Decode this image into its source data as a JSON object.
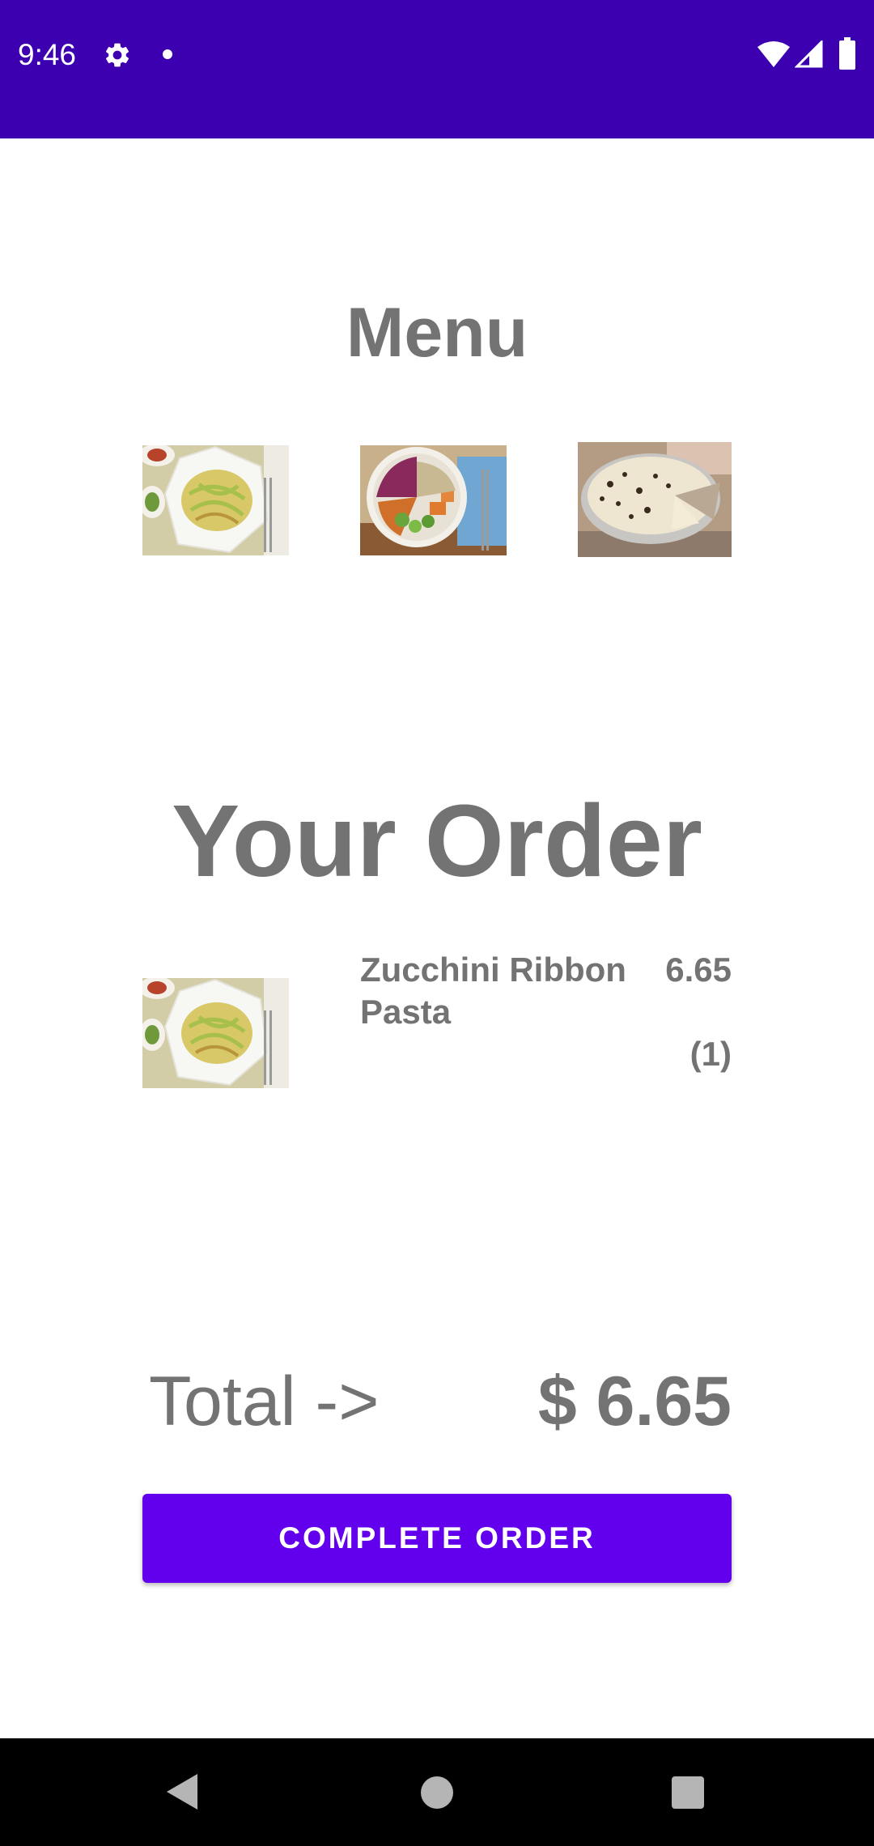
{
  "status_bar": {
    "time": "9:46",
    "background_color": "#3d00b0",
    "icons": [
      "settings-gear-icon",
      "notification-dot-icon",
      "wifi-icon",
      "cellular-signal-icon",
      "battery-icon"
    ]
  },
  "menu": {
    "title": "Menu",
    "items": [
      {
        "name": "Zucchini Ribbon Pasta",
        "icon": "pasta-dish-image"
      },
      {
        "name": "salad bowl",
        "icon": "salad-bowl-image"
      },
      {
        "name": "cream pie",
        "icon": "cream-pie-image"
      }
    ]
  },
  "order": {
    "title": "Your Order",
    "items": [
      {
        "name": "Zucchini Ribbon Pasta",
        "price": "6.65",
        "quantity": "(1)"
      }
    ]
  },
  "total": {
    "label": "Total ->",
    "value": "$ 6.65"
  },
  "complete_button": {
    "label": "COMPLETE ORDER",
    "color": "#6200ee"
  },
  "nav_bar": {
    "icons": [
      "back-triangle-icon",
      "home-circle-icon",
      "recents-square-icon"
    ]
  },
  "colors": {
    "text_gray": "#737373",
    "accent": "#6200ee",
    "status_bar": "#3d00b0"
  }
}
